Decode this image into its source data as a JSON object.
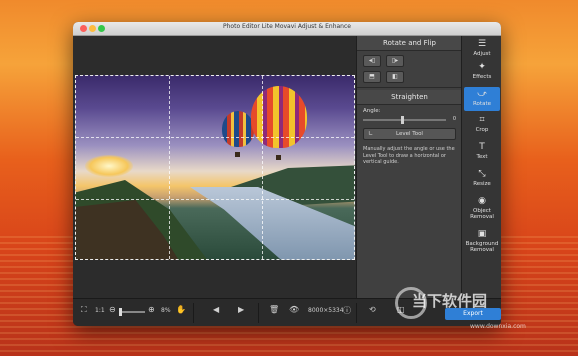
{
  "window": {
    "title": "Photo Editor Lite Movavi Adjust & Enhance"
  },
  "panel": {
    "rotate_flip_title": "Rotate and Flip",
    "straighten_title": "Straighten",
    "angle_label": "Angle:",
    "angle_value": "0",
    "level_tool_label": "Level Tool",
    "help_text": "Manually adjust the angle or use the Level Tool to draw a horizontal or vertical guide."
  },
  "tools": [
    {
      "label": "Adjust",
      "icon": "sliders-icon"
    },
    {
      "label": "Effects",
      "icon": "effects-icon"
    },
    {
      "label": "Rotate",
      "icon": "rotate-icon",
      "active": true
    },
    {
      "label": "Crop",
      "icon": "crop-icon"
    },
    {
      "label": "Text",
      "icon": "text-icon"
    },
    {
      "label": "Resize",
      "icon": "resize-icon"
    },
    {
      "label": "Object Removal",
      "icon": "object-removal-icon"
    },
    {
      "label": "Background Removal",
      "icon": "background-removal-icon"
    }
  ],
  "bottombar": {
    "zoom_ratio": "1:1",
    "zoom_percent": "8%",
    "dimensions": "8000×5334",
    "export_label": "Export"
  },
  "watermark": {
    "brand": "当下软件园",
    "url": "www.downxia.com"
  },
  "colors": {
    "accent": "#2f7fd6",
    "panel_bg": "#404040",
    "canvas_bg": "#2c2c2c"
  }
}
